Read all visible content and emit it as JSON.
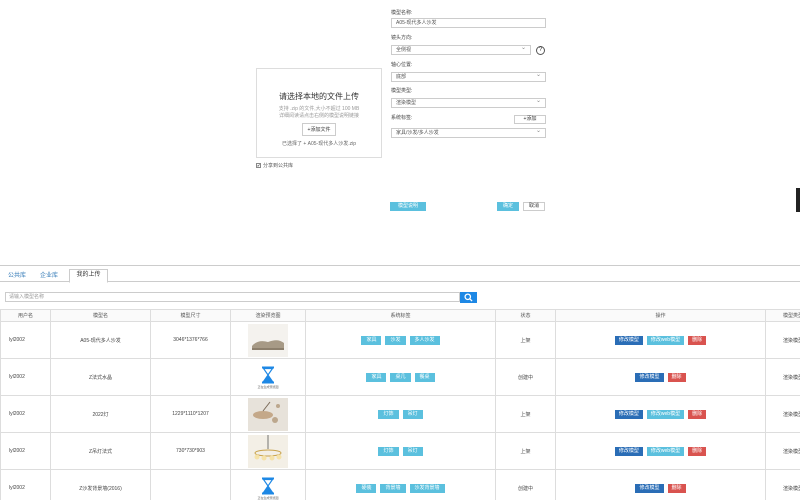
{
  "upload": {
    "title": "请选择本地的文件上传",
    "hint_line1": "支持 .zip 的文件,大小不超过 100 MB",
    "hint_line2": "详细阅读请点击右侧的模型说明链接",
    "add_file_label": "+添加文件",
    "chosen_file": "已选择了 + A05-现代多人沙发.zip",
    "share_label": "分享到公共库",
    "share_checked": "✔"
  },
  "form": {
    "name_label": "模型名称:",
    "name_value": "A05-现代多人沙发",
    "orientation_label": "镜头方向:",
    "orientation_value": "全侧视",
    "axis_label": "轴心位置:",
    "axis_value": "底部",
    "type_label": "模型类型:",
    "type_value": "渲染模型",
    "tag_label": "系统标签:",
    "add_tag_label": "+添加",
    "tag_value": "家具/沙发/多人沙发",
    "help_symbol": "?"
  },
  "actions": {
    "model_doc": "模型说明",
    "confirm": "确定",
    "cancel": "取消"
  },
  "library": {
    "tabs": [
      "公共库",
      "企业库",
      "我的上传"
    ],
    "search_placeholder": "请输入模型名称",
    "columns": [
      "用户名",
      "模型名",
      "模型尺寸",
      "渲染预览图",
      "系统标签",
      "状态",
      "操作",
      "模型类型"
    ],
    "ops": {
      "edit": "修改模型",
      "web_edit": "修改web模型",
      "delete": "删除"
    },
    "hourglass_caption": "正在生成预览图",
    "rows": [
      {
        "user": "lyl2002",
        "name": "A05-现代多人沙发",
        "size": "3046*1376*766",
        "preview": "sofa",
        "tags": [
          "家具",
          "沙发",
          "多人沙发"
        ],
        "status": "上架",
        "ops": [
          "edit",
          "web_edit",
          "delete"
        ],
        "model_type": "渲染模型"
      },
      {
        "user": "lyl2002",
        "name": "Z法式水晶",
        "size": "",
        "preview": "hourglass",
        "tags": [
          "家具",
          "桌几",
          "餐桌"
        ],
        "status": "创建中",
        "ops": [
          "edit",
          "delete"
        ],
        "model_type": "渲染模型"
      },
      {
        "user": "lyl2002",
        "name": "2022灯",
        "size": "1229*1110*1207",
        "preview": "lamp",
        "tags": [
          "灯饰",
          "吊灯"
        ],
        "status": "上架",
        "ops": [
          "edit",
          "web_edit",
          "delete"
        ],
        "model_type": "渲染模型"
      },
      {
        "user": "lyl2002",
        "name": "Z吊灯法式",
        "size": "730*730*903",
        "preview": "chandelier",
        "tags": [
          "灯饰",
          "吊灯"
        ],
        "status": "上架",
        "ops": [
          "edit",
          "web_edit",
          "delete"
        ],
        "model_type": "渲染模型"
      },
      {
        "user": "lyl2002",
        "name": "Z沙发背景墙(2016)",
        "size": "",
        "preview": "hourglass",
        "tags": [
          "硬装",
          "背景墙",
          "沙发背景墙"
        ],
        "status": "创建中",
        "ops": [
          "edit",
          "delete"
        ],
        "model_type": "渲染模型"
      }
    ]
  },
  "colors": {
    "tag_bg": "#5bc0de",
    "edit_bg": "#2a6db6",
    "delete_bg": "#d9534f",
    "search_btn": "#1e88e5"
  },
  "icons": {
    "search": "search-icon",
    "help": "help-icon",
    "hourglass": "hourglass-icon",
    "dropdown": "chevron-down-icon"
  }
}
